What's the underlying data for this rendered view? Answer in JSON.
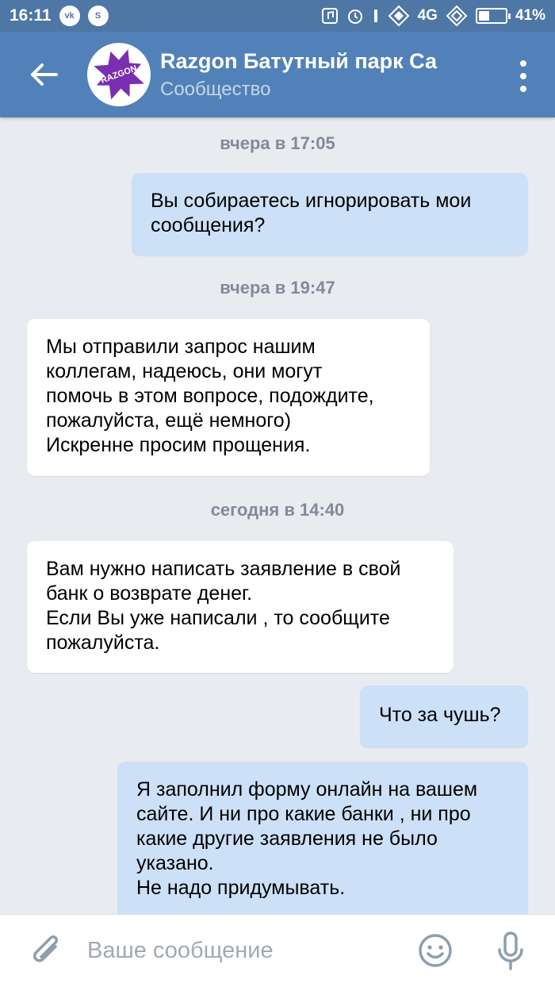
{
  "status_bar": {
    "time": "16:11",
    "network": "4G",
    "battery": "41%",
    "battery_level": 0.41
  },
  "header": {
    "title": "Razgon Батутный парк Са",
    "subtitle": "Сообщество",
    "avatar_text": "RAZGON"
  },
  "messages": [
    {
      "type": "date",
      "text": "вчера в 17:05"
    },
    {
      "type": "out",
      "lines": [
        "Вы собираетесь игнорировать мои",
        "сообщения?"
      ]
    },
    {
      "type": "date",
      "text": "вчера в 19:47"
    },
    {
      "type": "in",
      "lines": [
        "Мы отправили запрос нашим",
        "коллегам, надеюсь, они могут",
        "помочь в этом вопросе, подождите,",
        "пожалуйста, ещё немного)",
        "Искренне просим прощения."
      ]
    },
    {
      "type": "date",
      "text": "сегодня в 14:40"
    },
    {
      "type": "in",
      "lines": [
        "Вам нужно написать заявление в свой",
        "банк о возврате денег.",
        "Если Вы уже написали , то сообщите",
        "пожалуйста."
      ]
    },
    {
      "type": "out",
      "lines": [
        "Что за чушь?"
      ]
    },
    {
      "type": "out",
      "lines": [
        "Я заполнил форму онлайн на вашем",
        "сайте. И ни про какие банки , ни про",
        "какие другие заявления не было",
        "указано.",
        "Не надо придумывать."
      ]
    }
  ],
  "input": {
    "placeholder": "Ваше сообщение",
    "value": ""
  }
}
